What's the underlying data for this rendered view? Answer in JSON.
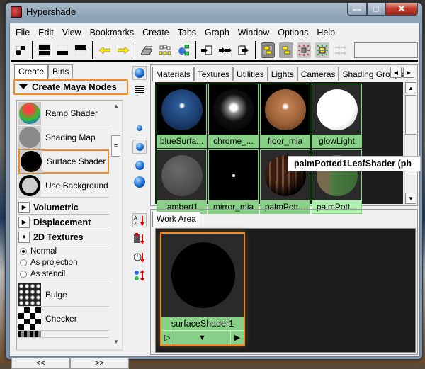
{
  "window": {
    "title": "Hypershade",
    "controls": {
      "minimize": "—",
      "maximize": "□",
      "close": "✕"
    }
  },
  "menubar": [
    "File",
    "Edit",
    "View",
    "Bookmarks",
    "Create",
    "Tabs",
    "Graph",
    "Window",
    "Options",
    "Help"
  ],
  "toolbar": {
    "icons": [
      "show-top-and-bottom-tabs-icon",
      "show-top-tabs-only-icon",
      "show-bottom-tabs-only-icon",
      "show-previous-graph-icon",
      "show-next-graph-icon",
      "clear-graph-icon",
      "rearrange-graph-icon",
      "graph-materials-on-selected-icon",
      "input-connections-icon",
      "input-output-connections-icon",
      "output-connections-icon",
      "show-top-tabs-icon",
      "show-bottom-tab-icon",
      "frame-all-icon",
      "frame-selection-icon",
      "pan-icon"
    ]
  },
  "left_panel": {
    "tabs": [
      "Create",
      "Bins"
    ],
    "active_tab": "Create",
    "header": "Create Maya Nodes",
    "shader_items": [
      {
        "label": "Ramp Shader",
        "icon": "ramp-shader-swatch"
      },
      {
        "label": "Shading Map",
        "icon": "shading-map-swatch"
      },
      {
        "label": "Surface Shader",
        "icon": "surface-shader-swatch",
        "highlighted": true
      },
      {
        "label": "Use Background",
        "icon": "use-background-swatch"
      }
    ],
    "sections": [
      {
        "label": "Volumetric",
        "expanded": false
      },
      {
        "label": "Displacement",
        "expanded": false
      },
      {
        "label": "2D Textures",
        "expanded": true
      }
    ],
    "texture_modes": [
      {
        "label": "Normal",
        "selected": true
      },
      {
        "label": "As projection",
        "selected": false
      },
      {
        "label": "As stencil",
        "selected": false
      }
    ],
    "texture_items": [
      {
        "label": "Bulge",
        "icon": "bulge-swatch"
      },
      {
        "label": "Checker",
        "icon": "checker-swatch"
      }
    ],
    "nav": {
      "prev": "<<",
      "next": ">>"
    }
  },
  "material_browser": {
    "tabs": [
      "Materials",
      "Textures",
      "Utilities",
      "Lights",
      "Cameras",
      "Shading Groups"
    ],
    "active_tab": "Materials",
    "swatches": [
      {
        "label": "blueSurfa...",
        "color": "#1f4f8a"
      },
      {
        "label": "chrome_...",
        "color": "#000000"
      },
      {
        "label": "floor_mia",
        "color": "#a86a3a"
      },
      {
        "label": "glowLight",
        "color": "#ffffff"
      },
      {
        "label": "lambert1",
        "color": "#5a5a5a"
      },
      {
        "label": "mirror_mia",
        "color": "#000000"
      },
      {
        "label": "palmPott...",
        "color": "#4a3020"
      },
      {
        "label": "palmPott...",
        "color": "#4a7a40"
      }
    ],
    "tooltip": "palmPotted1LeafShader (ph"
  },
  "work_area": {
    "tab": "Work Area",
    "node": {
      "label": "surfaceShader1"
    }
  },
  "colors": {
    "accent_orange": "#f08a24",
    "swatch_label_green": "#88d088"
  }
}
